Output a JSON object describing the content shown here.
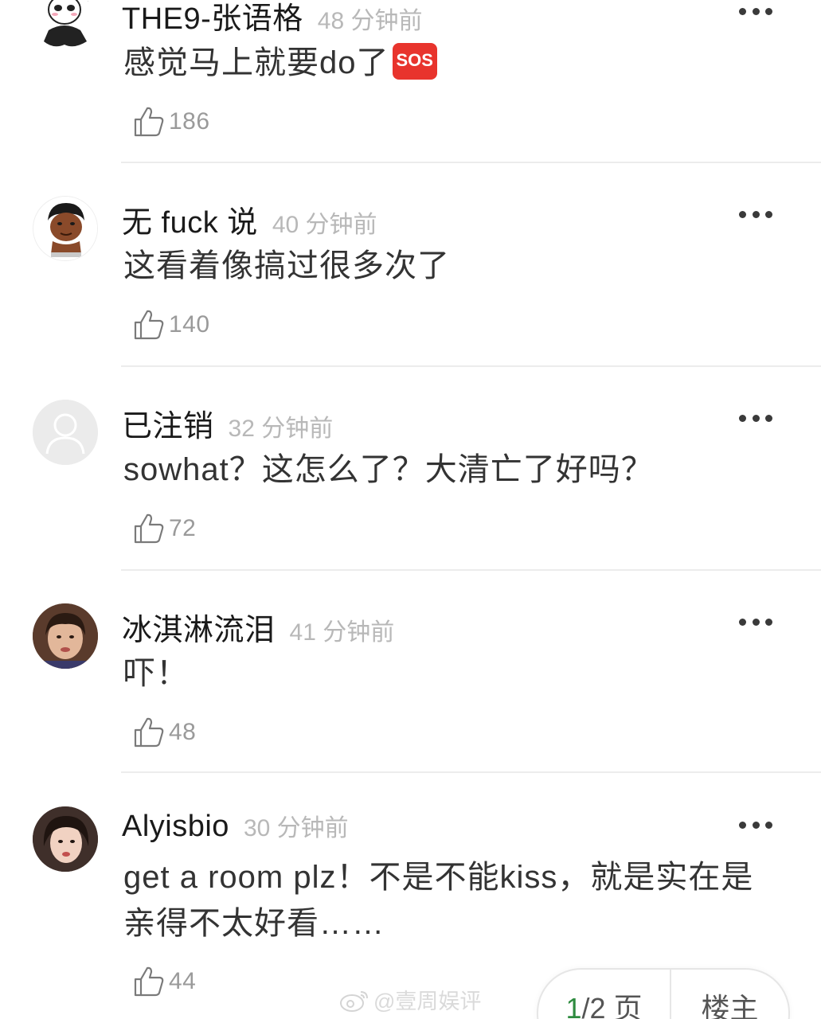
{
  "comments": [
    {
      "username": "THE9-张语格",
      "time": "48 分钟前",
      "text": "感觉马上就要do了",
      "emoji": "SOS",
      "likes": "186",
      "avatar": "panda-avatar"
    },
    {
      "username": "无 fuck 说",
      "time": "40 分钟前",
      "text": "这看着像搞过很多次了",
      "likes": "140",
      "avatar": "cartoon-avatar"
    },
    {
      "username": "已注销",
      "time": "32 分钟前",
      "text": "sowhat？这怎么了？大清亡了好吗？",
      "likes": "72",
      "avatar": "default-user-avatar"
    },
    {
      "username": "冰淇淋流泪",
      "time": "41 分钟前",
      "text": "吓！",
      "likes": "48",
      "avatar": "photo-avatar"
    },
    {
      "username": "Alyisbio",
      "time": "30 分钟前",
      "text": "get a room plz！不是不能kiss，就是实在是亲得不太好看……",
      "likes": "44",
      "avatar": "photo-avatar"
    }
  ],
  "watermark": "@壹周娱评",
  "pager": {
    "current": "1",
    "total": "/2 页",
    "owner_label": "楼主"
  },
  "colors": {
    "sos": "#e8342d",
    "current_page": "#2e8b3f",
    "timestamp": "#b8b8b8"
  }
}
